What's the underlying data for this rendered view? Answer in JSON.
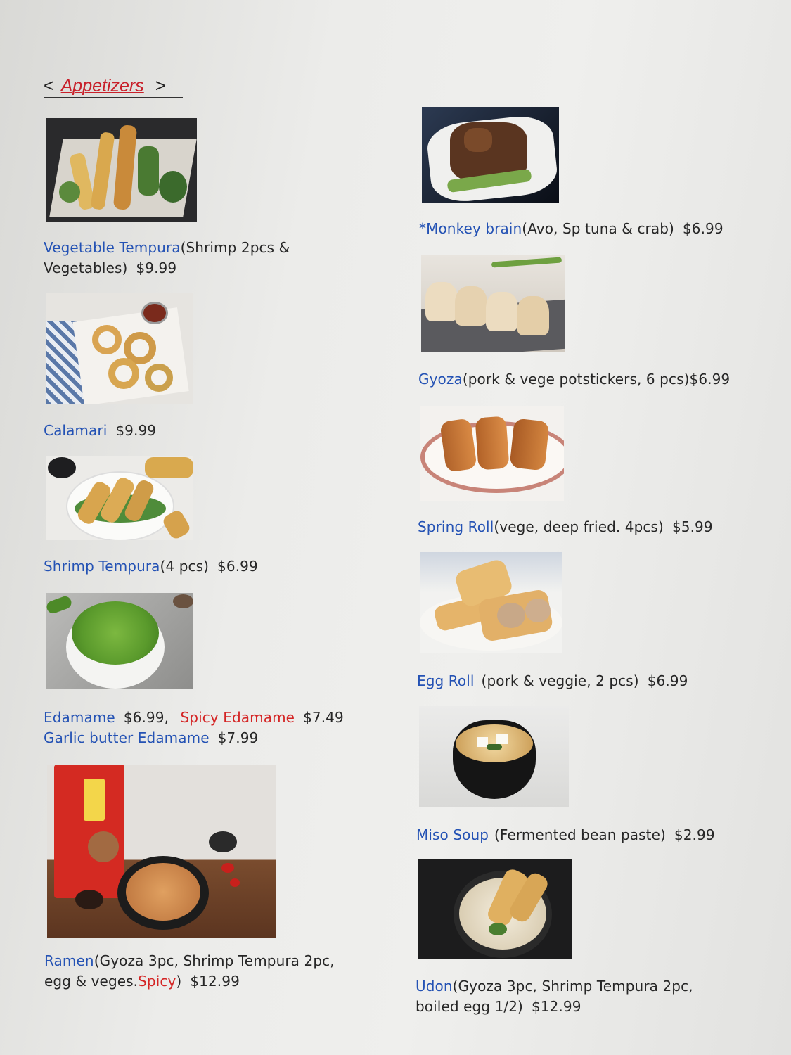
{
  "header": {
    "prev": "<",
    "title": "Appetizers",
    "next": ">"
  },
  "items": [
    {
      "id": "vegetable-tempura",
      "name": "Vegetable Tempura",
      "desc": "(Shrimp 2pcs &",
      "desc2": "Vegetables)",
      "price": "$9.99"
    },
    {
      "id": "calamari",
      "name": "Calamari",
      "price": "$9.99"
    },
    {
      "id": "shrimp-tempura",
      "name": "Shrimp Tempura",
      "desc": "(4 pcs)",
      "price": "$6.99"
    },
    {
      "id": "edamame",
      "name": "Edamame",
      "price": "$6.99,",
      "spicy_name": "Spicy Edamame",
      "spicy_price": "$7.49",
      "garlic_name": "Garlic butter Edamame",
      "garlic_price": "$7.99"
    },
    {
      "id": "ramen",
      "name": "Ramen",
      "desc": "(Gyoza 3pc, Shrimp Tempura 2pc,",
      "desc2a": "egg & veges.",
      "spicy": "Spicy",
      "desc2b": ")",
      "price": "$12.99"
    },
    {
      "id": "monkey-brain",
      "name": "*Monkey brain",
      "desc": "(Avo, Sp tuna & crab)",
      "price": "$6.99"
    },
    {
      "id": "gyoza",
      "name": "Gyoza",
      "desc": "(pork & vege potstickers, 6 pcs)",
      "price": "$6.99"
    },
    {
      "id": "spring-roll",
      "name": "Spring Roll",
      "desc": "(vege, deep fried. 4pcs)",
      "price": "$5.99"
    },
    {
      "id": "egg-roll",
      "name": "Egg Roll",
      "desc": "(pork & veggie, 2 pcs)",
      "price": "$6.99"
    },
    {
      "id": "miso-soup",
      "name": "Miso Soup",
      "desc": "(Fermented bean paste)",
      "price": "$2.99"
    },
    {
      "id": "udon",
      "name": "Udon",
      "desc": "(Gyoza 3pc, Shrimp Tempura 2pc,",
      "desc2": "boiled egg 1/2)",
      "price": "$12.99"
    }
  ]
}
